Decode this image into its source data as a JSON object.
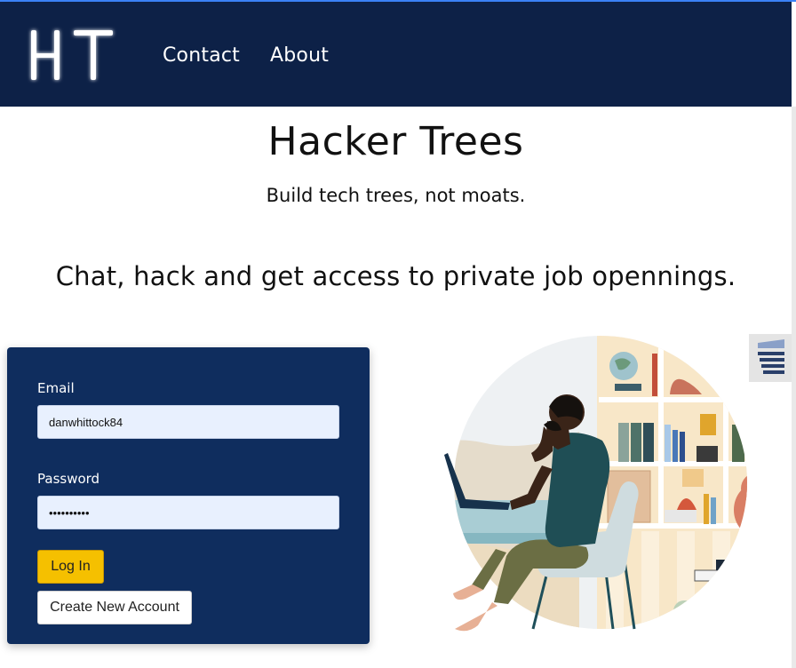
{
  "header": {
    "logo_text": "HT",
    "nav": [
      {
        "label": "Contact"
      },
      {
        "label": "About"
      }
    ]
  },
  "hero": {
    "title": "Hacker Trees",
    "subtitle": "Build tech trees, not moats.",
    "tagline": "Chat, hack and get access to private job opennings."
  },
  "login": {
    "email_label": "Email",
    "email_value": "danwhittock84",
    "password_label": "Password",
    "password_value": "••••••••••",
    "login_button": "Log In",
    "create_button": "Create New Account"
  },
  "colors": {
    "navbar": "#0d2147",
    "card": "#0f2d5e",
    "login_button": "#f5c000",
    "input_bg": "#e8f0fe"
  },
  "illustration": {
    "icon": "person-working-on-laptop-illustration"
  },
  "side_widget": {
    "icon": "stack-widget-icon"
  }
}
